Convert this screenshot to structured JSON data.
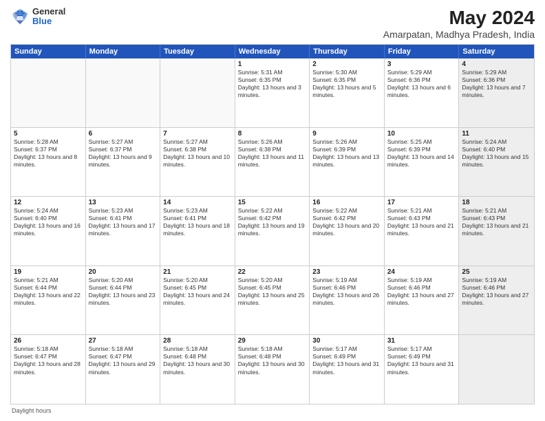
{
  "header": {
    "logo_general": "General",
    "logo_blue": "Blue",
    "title": "May 2024",
    "subtitle": "Amarpatan, Madhya Pradesh, India"
  },
  "calendar": {
    "days_of_week": [
      "Sunday",
      "Monday",
      "Tuesday",
      "Wednesday",
      "Thursday",
      "Friday",
      "Saturday"
    ],
    "rows": [
      [
        {
          "day": "",
          "content": "",
          "shaded": false
        },
        {
          "day": "",
          "content": "",
          "shaded": false
        },
        {
          "day": "",
          "content": "",
          "shaded": false
        },
        {
          "day": "1",
          "content": "Sunrise: 5:31 AM\nSunset: 6:35 PM\nDaylight: 13 hours and 3 minutes.",
          "shaded": false
        },
        {
          "day": "2",
          "content": "Sunrise: 5:30 AM\nSunset: 6:35 PM\nDaylight: 13 hours and 5 minutes.",
          "shaded": false
        },
        {
          "day": "3",
          "content": "Sunrise: 5:29 AM\nSunset: 6:36 PM\nDaylight: 13 hours and 6 minutes.",
          "shaded": false
        },
        {
          "day": "4",
          "content": "Sunrise: 5:29 AM\nSunset: 6:36 PM\nDaylight: 13 hours and 7 minutes.",
          "shaded": true
        }
      ],
      [
        {
          "day": "5",
          "content": "Sunrise: 5:28 AM\nSunset: 6:37 PM\nDaylight: 13 hours and 8 minutes.",
          "shaded": false
        },
        {
          "day": "6",
          "content": "Sunrise: 5:27 AM\nSunset: 6:37 PM\nDaylight: 13 hours and 9 minutes.",
          "shaded": false
        },
        {
          "day": "7",
          "content": "Sunrise: 5:27 AM\nSunset: 6:38 PM\nDaylight: 13 hours and 10 minutes.",
          "shaded": false
        },
        {
          "day": "8",
          "content": "Sunrise: 5:26 AM\nSunset: 6:38 PM\nDaylight: 13 hours and 11 minutes.",
          "shaded": false
        },
        {
          "day": "9",
          "content": "Sunrise: 5:26 AM\nSunset: 6:39 PM\nDaylight: 13 hours and 13 minutes.",
          "shaded": false
        },
        {
          "day": "10",
          "content": "Sunrise: 5:25 AM\nSunset: 6:39 PM\nDaylight: 13 hours and 14 minutes.",
          "shaded": false
        },
        {
          "day": "11",
          "content": "Sunrise: 5:24 AM\nSunset: 6:40 PM\nDaylight: 13 hours and 15 minutes.",
          "shaded": true
        }
      ],
      [
        {
          "day": "12",
          "content": "Sunrise: 5:24 AM\nSunset: 6:40 PM\nDaylight: 13 hours and 16 minutes.",
          "shaded": false
        },
        {
          "day": "13",
          "content": "Sunrise: 5:23 AM\nSunset: 6:41 PM\nDaylight: 13 hours and 17 minutes.",
          "shaded": false
        },
        {
          "day": "14",
          "content": "Sunrise: 5:23 AM\nSunset: 6:41 PM\nDaylight: 13 hours and 18 minutes.",
          "shaded": false
        },
        {
          "day": "15",
          "content": "Sunrise: 5:22 AM\nSunset: 6:42 PM\nDaylight: 13 hours and 19 minutes.",
          "shaded": false
        },
        {
          "day": "16",
          "content": "Sunrise: 5:22 AM\nSunset: 6:42 PM\nDaylight: 13 hours and 20 minutes.",
          "shaded": false
        },
        {
          "day": "17",
          "content": "Sunrise: 5:21 AM\nSunset: 6:43 PM\nDaylight: 13 hours and 21 minutes.",
          "shaded": false
        },
        {
          "day": "18",
          "content": "Sunrise: 5:21 AM\nSunset: 6:43 PM\nDaylight: 13 hours and 21 minutes.",
          "shaded": true
        }
      ],
      [
        {
          "day": "19",
          "content": "Sunrise: 5:21 AM\nSunset: 6:44 PM\nDaylight: 13 hours and 22 minutes.",
          "shaded": false
        },
        {
          "day": "20",
          "content": "Sunrise: 5:20 AM\nSunset: 6:44 PM\nDaylight: 13 hours and 23 minutes.",
          "shaded": false
        },
        {
          "day": "21",
          "content": "Sunrise: 5:20 AM\nSunset: 6:45 PM\nDaylight: 13 hours and 24 minutes.",
          "shaded": false
        },
        {
          "day": "22",
          "content": "Sunrise: 5:20 AM\nSunset: 6:45 PM\nDaylight: 13 hours and 25 minutes.",
          "shaded": false
        },
        {
          "day": "23",
          "content": "Sunrise: 5:19 AM\nSunset: 6:46 PM\nDaylight: 13 hours and 26 minutes.",
          "shaded": false
        },
        {
          "day": "24",
          "content": "Sunrise: 5:19 AM\nSunset: 6:46 PM\nDaylight: 13 hours and 27 minutes.",
          "shaded": false
        },
        {
          "day": "25",
          "content": "Sunrise: 5:19 AM\nSunset: 6:46 PM\nDaylight: 13 hours and 27 minutes.",
          "shaded": true
        }
      ],
      [
        {
          "day": "26",
          "content": "Sunrise: 5:18 AM\nSunset: 6:47 PM\nDaylight: 13 hours and 28 minutes.",
          "shaded": false
        },
        {
          "day": "27",
          "content": "Sunrise: 5:18 AM\nSunset: 6:47 PM\nDaylight: 13 hours and 29 minutes.",
          "shaded": false
        },
        {
          "day": "28",
          "content": "Sunrise: 5:18 AM\nSunset: 6:48 PM\nDaylight: 13 hours and 30 minutes.",
          "shaded": false
        },
        {
          "day": "29",
          "content": "Sunrise: 5:18 AM\nSunset: 6:48 PM\nDaylight: 13 hours and 30 minutes.",
          "shaded": false
        },
        {
          "day": "30",
          "content": "Sunrise: 5:17 AM\nSunset: 6:49 PM\nDaylight: 13 hours and 31 minutes.",
          "shaded": false
        },
        {
          "day": "31",
          "content": "Sunrise: 5:17 AM\nSunset: 6:49 PM\nDaylight: 13 hours and 31 minutes.",
          "shaded": false
        },
        {
          "day": "",
          "content": "",
          "shaded": true
        }
      ]
    ]
  },
  "footer": {
    "note": "Daylight hours"
  }
}
